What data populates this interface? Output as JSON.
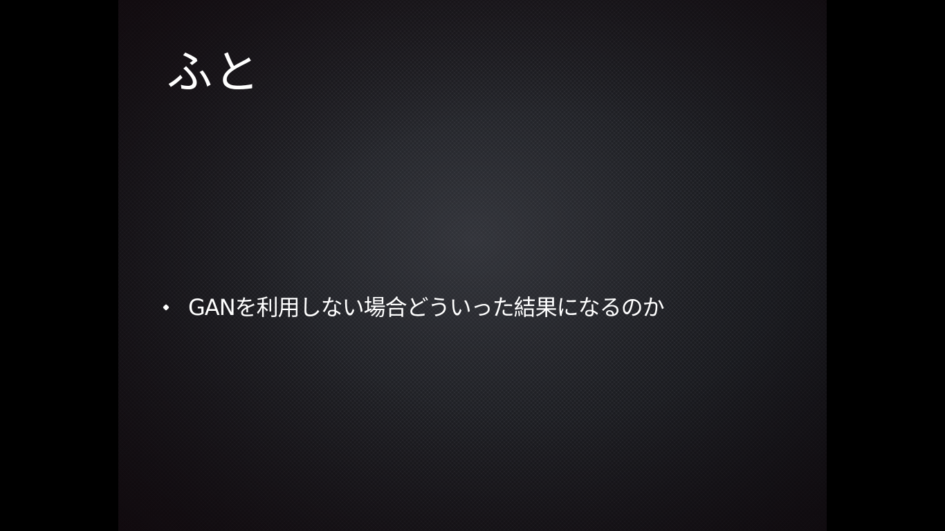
{
  "slide": {
    "title": "ふと",
    "bullets": [
      {
        "text": "GANを利用しない場合どういった結果になるのか"
      }
    ]
  },
  "colors": {
    "letterbox": "#000000",
    "slide_base": "#2a2b30",
    "text": "#ffffff"
  }
}
